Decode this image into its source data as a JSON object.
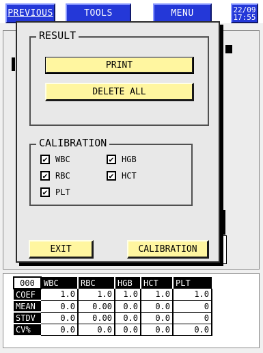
{
  "topbar": {
    "previous_label": "PREVIOUS",
    "tools_label": "TOOLS",
    "menu_label": "MENU",
    "date": "22/09",
    "time": "17:55"
  },
  "dialog": {
    "result_group": {
      "title": "RESULT",
      "print_label": "PRINT",
      "delete_all_label": "DELETE ALL"
    },
    "calibration_group": {
      "title": "CALIBRATION",
      "checkboxes": [
        {
          "label": "WBC",
          "checked": true
        },
        {
          "label": "HGB",
          "checked": true
        },
        {
          "label": "RBC",
          "checked": true
        },
        {
          "label": "HCT",
          "checked": true
        },
        {
          "label": "PLT",
          "checked": true
        }
      ]
    },
    "exit_label": "EXIT",
    "calibration_label": "CALIBRATION"
  },
  "stats_table": {
    "corner": "000",
    "columns": [
      "WBC",
      "RBC",
      "HGB",
      "HCT",
      "PLT"
    ],
    "rows": [
      {
        "label": "COEF",
        "values": [
          "1.0",
          "1.0",
          "1.0",
          "1.0",
          "1.0"
        ]
      },
      {
        "label": "MEAN",
        "values": [
          "0.0",
          "0.00",
          "0.0",
          "0.0",
          "0"
        ]
      },
      {
        "label": "STDV",
        "values": [
          "0.0",
          "0.00",
          "0.0",
          "0.0",
          "0"
        ]
      },
      {
        "label": "CV%",
        "values": [
          "0.0",
          "0.0",
          "0.0",
          "0.0",
          "0.0"
        ]
      }
    ]
  },
  "colors": {
    "nav_blue": "#2438d8",
    "button_yellow": "#fff6a0",
    "dialog_bg": "#e8e8e8"
  },
  "icons": {
    "checkmark": "check-icon"
  }
}
